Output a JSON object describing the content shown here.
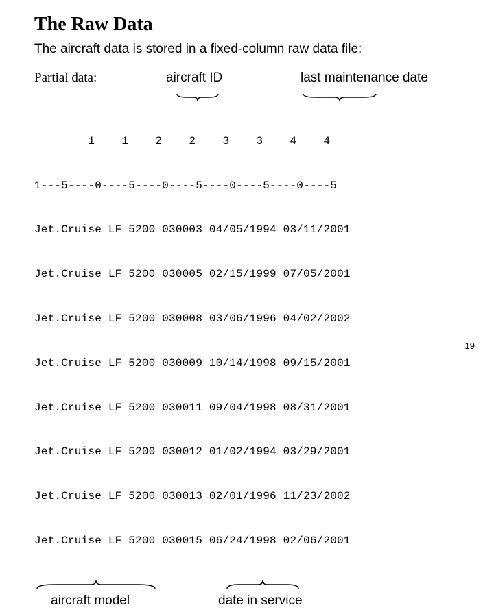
{
  "title": "The Raw Data",
  "subtitle": "The aircraft data is stored in a fixed-column raw data file:",
  "partial_label": "Partial data:",
  "labels": {
    "aircraft_id": "aircraft ID",
    "last_maint": "last maintenance date",
    "aircraft_model": "aircraft model",
    "date_in_service": "date in service"
  },
  "ruler_top": "        1    1    2    2    3    3    4    4",
  "ruler_bottom": "1---5----0----5----0----5----0----5----0----5",
  "rows": [
    "Jet.Cruise LF 5200 030003 04/05/1994 03/11/2001",
    "Jet.Cruise LF 5200 030005 02/15/1999 07/05/2001",
    "Jet.Cruise LF 5200 030008 03/06/1996 04/02/2002",
    "Jet.Cruise LF 5200 030009 10/14/1998 09/15/2001",
    "Jet.Cruise LF 5200 030011 09/04/1998 08/31/2001",
    "Jet.Cruise LF 5200 030012 01/02/1994 03/29/2001",
    "Jet.Cruise LF 5200 030013 02/01/1996 11/23/2002",
    "Jet.Cruise LF 5200 030015 06/24/1998 02/06/2001"
  ],
  "page_number": "19"
}
